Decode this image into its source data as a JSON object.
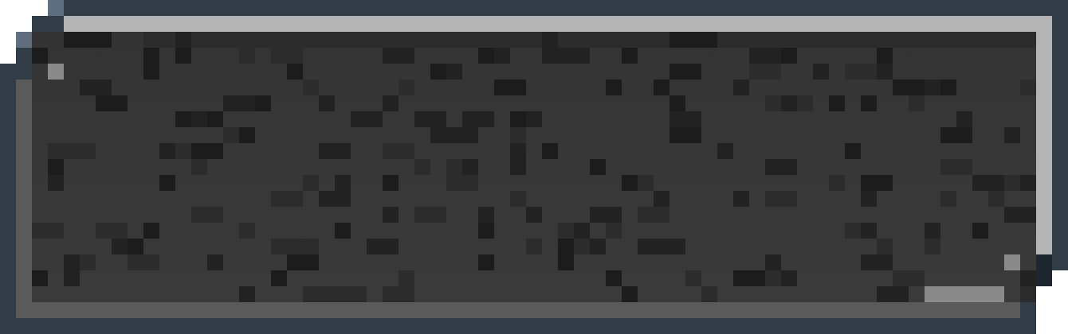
{
  "panel": {
    "kind": "pixel-art-stone-panel",
    "colors": {
      "outline": "#333d48",
      "bevel_light": "#b4b4b4",
      "bevel_mid": "#8a8a8a",
      "bevel_dark": "#5a5a5a",
      "stone_base": "#343434",
      "stone_lower": "#3a3a3a",
      "stone_dark_pixel": "#222222",
      "stone_deep_pixel": "#1c1c1c",
      "stone_mid_pixel": "#2c2c2c",
      "corner_white": "#ffffff"
    }
  }
}
